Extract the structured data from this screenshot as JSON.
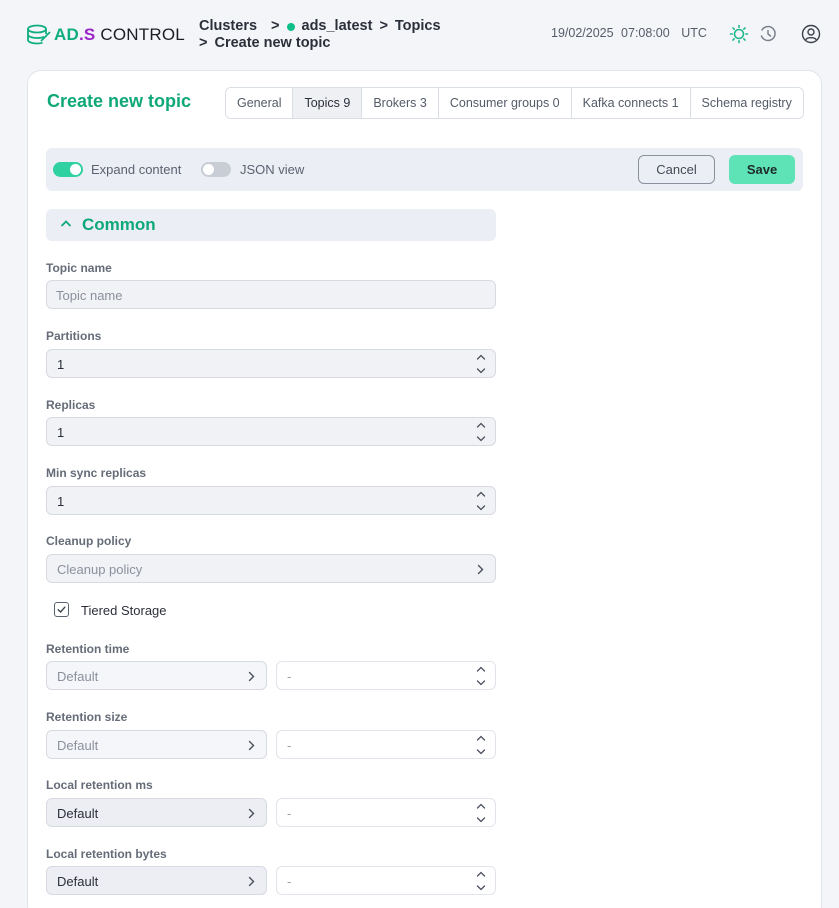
{
  "brand": {
    "ad": "AD",
    "dot": ".",
    "s": "S",
    "rest": " CONTROL"
  },
  "breadcrumb": {
    "clusters": "Clusters",
    "sep": ">",
    "cluster": "ads_latest",
    "topics": "Topics",
    "current": "Create new topic"
  },
  "header": {
    "date": "19/02/2025",
    "time": "07:08:00",
    "tz": "UTC"
  },
  "page": {
    "title": "Create new topic"
  },
  "tabs": [
    {
      "label": "General"
    },
    {
      "label": "Topics 9"
    },
    {
      "label": "Brokers 3"
    },
    {
      "label": "Consumer groups 0"
    },
    {
      "label": "Kafka connects 1"
    },
    {
      "label": "Schema registry"
    }
  ],
  "toolbar": {
    "expand_label": "Expand content",
    "expand_on": true,
    "json_label": "JSON view",
    "json_on": false,
    "cancel": "Cancel",
    "save": "Save"
  },
  "section": {
    "title": "Common"
  },
  "form": {
    "topic_name": {
      "label": "Topic name",
      "placeholder": "Topic name"
    },
    "partitions": {
      "label": "Partitions",
      "value": "1"
    },
    "replicas": {
      "label": "Replicas",
      "value": "1"
    },
    "min_sync": {
      "label": "Min sync replicas",
      "value": "1"
    },
    "cleanup": {
      "label": "Cleanup policy",
      "placeholder": "Cleanup policy"
    },
    "tiered": {
      "label": "Tiered Storage",
      "checked": true
    },
    "retention_time": {
      "label": "Retention time",
      "select": "Default",
      "value": "-"
    },
    "retention_size": {
      "label": "Retention size",
      "select": "Default",
      "value": "-"
    },
    "local_ms": {
      "label": "Local retention ms",
      "select": "Default",
      "value": "-"
    },
    "local_bytes": {
      "label": "Local retention bytes",
      "select": "Default",
      "value": "-"
    }
  },
  "colors": {
    "accent": "#0fa878",
    "toggle_on": "#2fd1a0",
    "save": "#5ee3b7",
    "brand_s": "#9b24c8"
  }
}
